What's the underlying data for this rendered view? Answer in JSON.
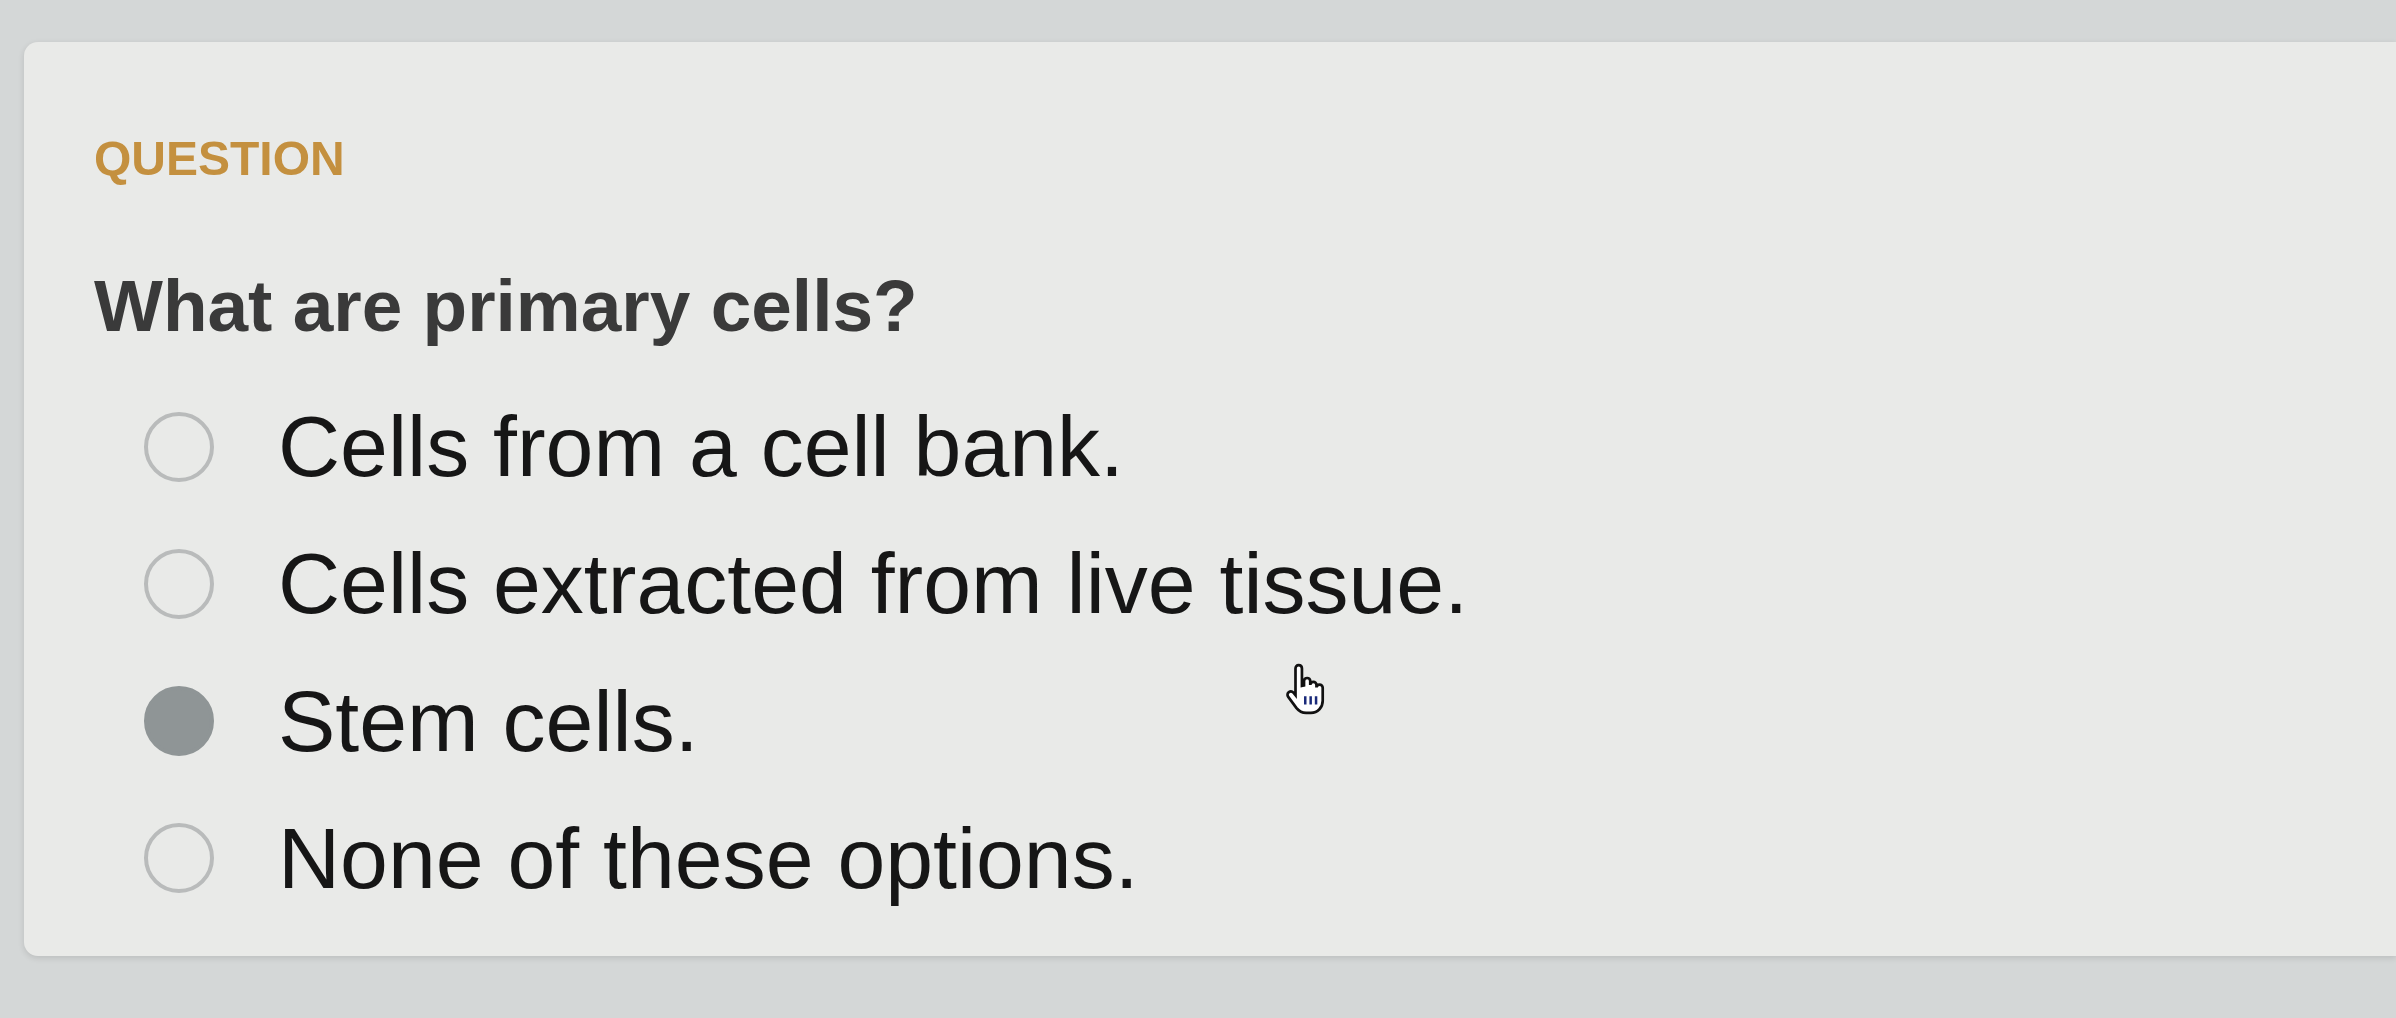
{
  "question": {
    "label": "QUESTION",
    "text": "What are primary cells?",
    "options": [
      {
        "text": "Cells from a cell bank.",
        "selected": false
      },
      {
        "text": "Cells extracted from live tissue.",
        "selected": false
      },
      {
        "text": "Stem cells.",
        "selected": true
      },
      {
        "text": "None of these options.",
        "selected": false
      }
    ]
  }
}
